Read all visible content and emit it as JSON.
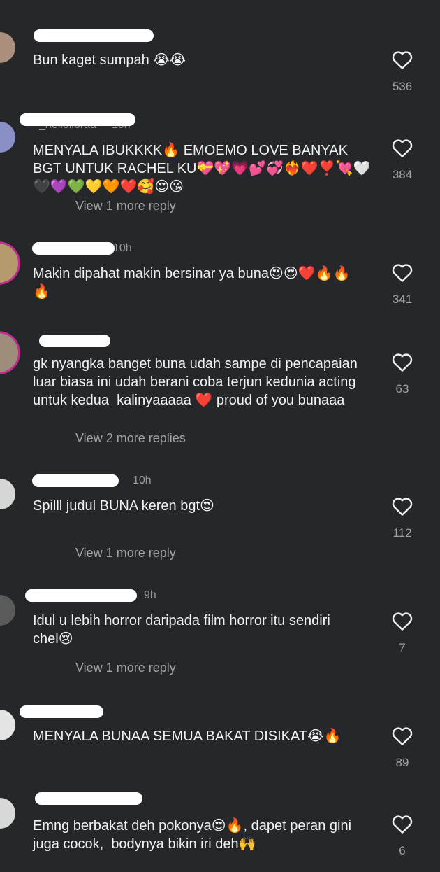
{
  "comments": [
    {
      "username": "",
      "time": "",
      "text": "Bun kaget sumpah 😭😭",
      "reply": "",
      "likes": "536"
    },
    {
      "username": "_hellolibraa",
      "time": "10h",
      "text": "MENYALA IBUKKKK🔥 EMOEMO LOVE BANYAK BGT UNTUK RACHEL KU💝💖💗💕💞❤️‍🔥❤️❣️💘🤍🖤💜💚💛🧡❤️🥰😍😘",
      "reply": "View 1 more reply",
      "likes": "384"
    },
    {
      "username": "",
      "time": "10h",
      "text": "Makin dipahat makin bersinar ya buna😍😍❤️🔥🔥🔥",
      "reply": "",
      "likes": "341"
    },
    {
      "username": "",
      "time": "",
      "text": "gk nyangka banget buna udah sampe di pencapaian luar biasa ini udah berani coba terjun kedunia acting untuk kedua  kalinyaaaaa ❤️ proud of you bunaaa",
      "reply": "View 2 more replies",
      "likes": "63"
    },
    {
      "username": "",
      "time": "10h",
      "text": "Spilll judul BUNA keren bgt😍",
      "reply": "View 1 more reply",
      "likes": "112"
    },
    {
      "username": "",
      "time": "9h",
      "text": "Idul u lebih horror daripada film horror itu sendiri chel😢",
      "reply": "View 1 more reply",
      "likes": "7"
    },
    {
      "username": "",
      "time": "",
      "text": "MENYALA BUNAA SEMUA BAKAT DISIKAT😭🔥",
      "reply": "",
      "likes": "89"
    },
    {
      "username": "",
      "time": "",
      "text": "Emng berbakat deh pokonya😍🔥, dapet peran gini juga cocok,  bodynya bikin iri deh🙌",
      "reply": "",
      "likes": "6"
    }
  ],
  "colors": {
    "background": "#25272b",
    "text": "#f2f2f2",
    "muted": "#9a9a9a",
    "story_ring": "#c22c8f"
  },
  "icons": {
    "like": "heart-outline-icon"
  }
}
